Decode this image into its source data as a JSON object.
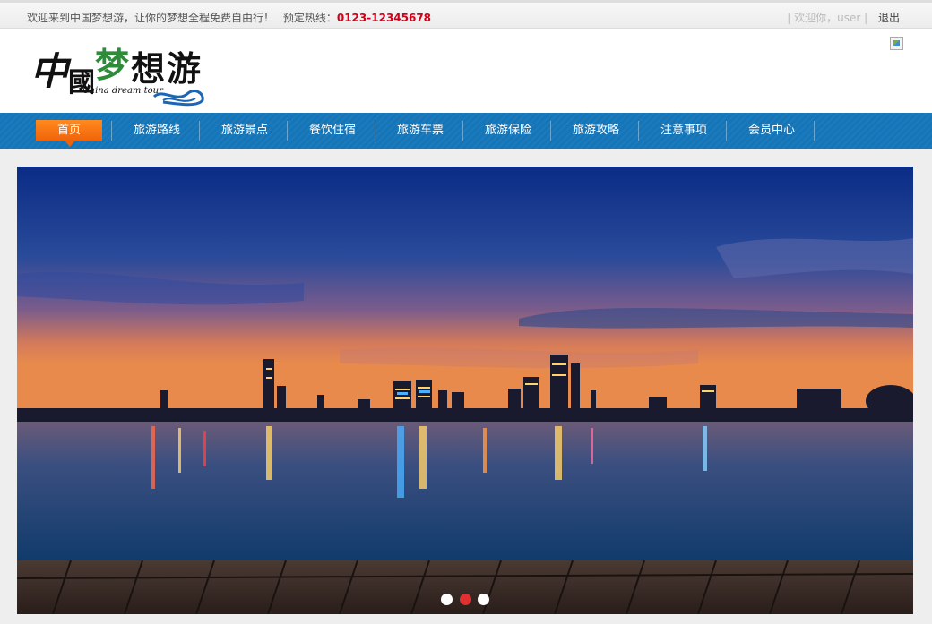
{
  "topbar": {
    "welcome_text": "欢迎来到中国梦想游，让你的梦想全程免费自由行！",
    "hotline_label": "预定热线：",
    "hotline_number": "0123-12345678",
    "greeting": "| 欢迎你，user |",
    "logout_label": "退出"
  },
  "logo": {
    "text_cn": "中國梦想游",
    "text_en": "China dream tour"
  },
  "nav": {
    "items": [
      {
        "label": "首页",
        "active": true
      },
      {
        "label": "旅游路线"
      },
      {
        "label": "旅游景点"
      },
      {
        "label": "餐饮住宿"
      },
      {
        "label": "旅游车票"
      },
      {
        "label": "旅游保险"
      },
      {
        "label": "旅游攻略"
      },
      {
        "label": "注意事项"
      },
      {
        "label": "会员中心"
      }
    ]
  },
  "banner": {
    "slide_count": 3,
    "active_slide": 2
  },
  "colors": {
    "nav_bg": "#1475b8",
    "nav_active": "#f0620a",
    "hotline": "#d0021b",
    "dot_active": "#e03030"
  }
}
